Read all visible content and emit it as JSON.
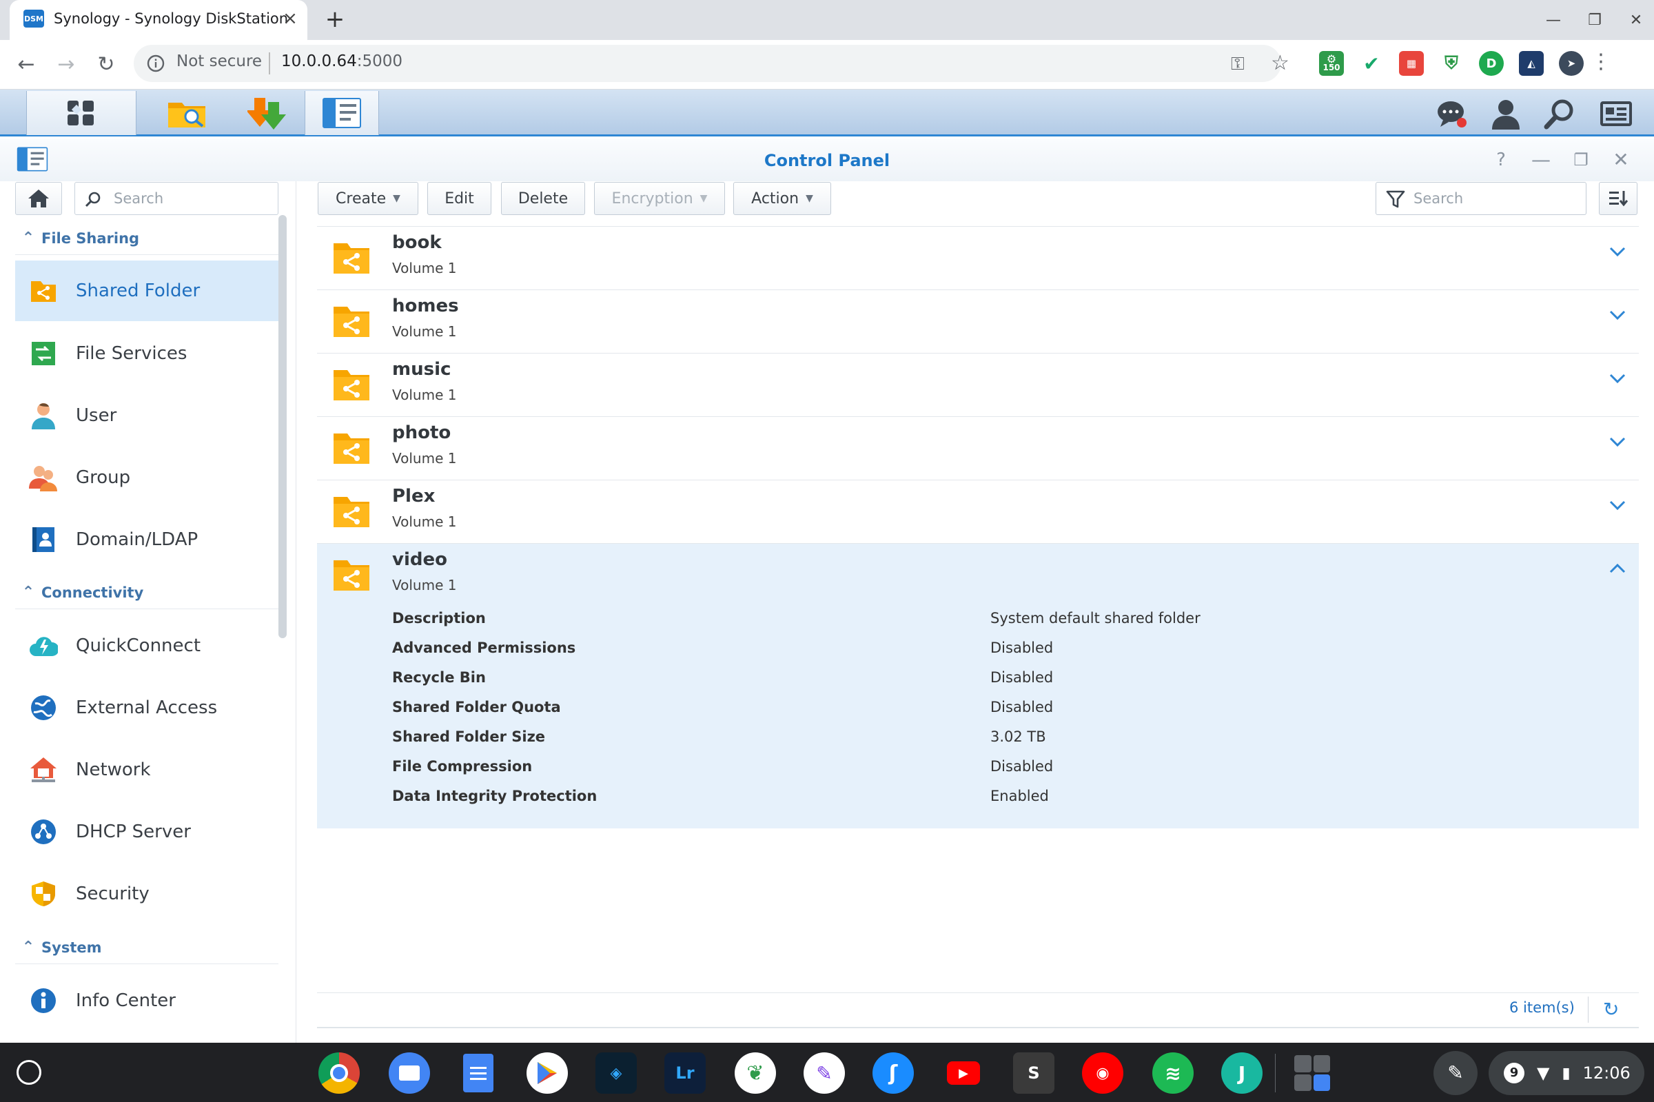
{
  "browser": {
    "tab_title": "Synology - Synology DiskStation",
    "favicon_text": "DSM",
    "security_label": "Not secure",
    "url_host": "10.0.0.64",
    "url_port": ":5000",
    "ext_badge": "150"
  },
  "window": {
    "title": "Control Panel"
  },
  "sidebar": {
    "search_placeholder": "Search",
    "categories": [
      {
        "label": "File Sharing"
      },
      {
        "label": "Connectivity"
      },
      {
        "label": "System"
      }
    ],
    "items": [
      {
        "label": "Shared Folder",
        "icon": "shared-folder-icon",
        "selected": true
      },
      {
        "label": "File Services",
        "icon": "file-services-icon"
      },
      {
        "label": "User",
        "icon": "user-icon"
      },
      {
        "label": "Group",
        "icon": "group-icon"
      },
      {
        "label": "Domain/LDAP",
        "icon": "domain-ldap-icon"
      },
      {
        "label": "QuickConnect",
        "icon": "quickconnect-icon"
      },
      {
        "label": "External Access",
        "icon": "external-access-icon"
      },
      {
        "label": "Network",
        "icon": "network-icon"
      },
      {
        "label": "DHCP Server",
        "icon": "dhcp-server-icon"
      },
      {
        "label": "Security",
        "icon": "security-icon"
      },
      {
        "label": "Info Center",
        "icon": "info-center-icon"
      }
    ]
  },
  "toolbar": {
    "create": "Create",
    "edit": "Edit",
    "delete": "Delete",
    "encryption": "Encryption",
    "action": "Action",
    "search_placeholder": "Search"
  },
  "folders": [
    {
      "name": "book",
      "volume": "Volume 1"
    },
    {
      "name": "homes",
      "volume": "Volume 1"
    },
    {
      "name": "music",
      "volume": "Volume 1"
    },
    {
      "name": "photo",
      "volume": "Volume 1"
    },
    {
      "name": "Plex",
      "volume": "Volume 1"
    },
    {
      "name": "video",
      "volume": "Volume 1",
      "expanded": true
    }
  ],
  "details": [
    {
      "key": "Description",
      "value": "System default shared folder"
    },
    {
      "key": "Advanced Permissions",
      "value": "Disabled"
    },
    {
      "key": "Recycle Bin",
      "value": "Disabled"
    },
    {
      "key": "Shared Folder Quota",
      "value": "Disabled"
    },
    {
      "key": "Shared Folder Size",
      "value": "3.02 TB"
    },
    {
      "key": "File Compression",
      "value": "Disabled"
    },
    {
      "key": "Data Integrity Protection",
      "value": "Enabled"
    }
  ],
  "footer": {
    "count": "6 item(s)"
  },
  "shelf": {
    "notif_count": "9",
    "clock": "12:06",
    "apps": [
      "chrome-icon",
      "files-icon",
      "docs-icon",
      "play-store-icon",
      "photoshop-express-icon",
      "lightroom-icon",
      "snapseed-icon",
      "writer-icon",
      "shazam-icon",
      "youtube-icon",
      "squid-icon",
      "youtube-music-icon",
      "spotify-icon",
      "journal-icon",
      "calculator-icon"
    ],
    "app_labels": {
      "lightroom": "Lr",
      "squid": "S",
      "journal": "J"
    }
  },
  "colors": {
    "accent": "#2e86d4",
    "folder": "#f7a500",
    "selected_bg": "#d8eafa",
    "expanded_bg": "#e6f1fb"
  }
}
